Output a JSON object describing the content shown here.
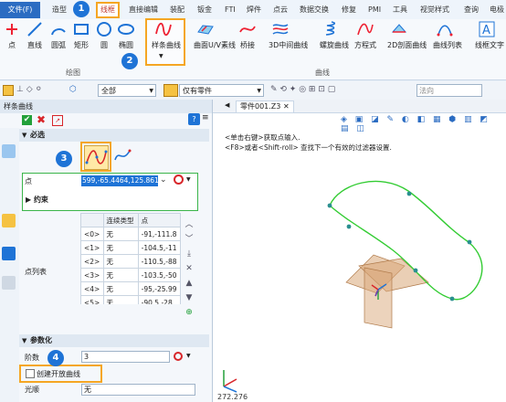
{
  "menu": {
    "file": "文件(F)",
    "tabs": [
      "造型",
      "线框",
      "直接编辑",
      "装配",
      "钣金",
      "FTI",
      "焊件",
      "点云",
      "数据交换",
      "修复",
      "PMI",
      "工具",
      "视觉样式",
      "查询",
      "电极"
    ]
  },
  "ribbon": {
    "buttons": [
      "点",
      "直线",
      "圆弧",
      "矩形",
      "圆",
      "椭圆",
      "样条曲线",
      "曲面U/V素线",
      "桥接",
      "3D中间曲线",
      "螺旋曲线",
      "方程式",
      "2D剖面曲线",
      "曲线列表",
      "线框文字"
    ],
    "groups": [
      "绘图",
      "曲线"
    ]
  },
  "toolbar": {
    "filter_value": "全部",
    "part_value": "仅有零件",
    "normal_label": "法向"
  },
  "panel": {
    "title": "样条曲线",
    "help": "?",
    "required_section": "必选",
    "point_label": "点",
    "point_value": "599,-65.4464,125.861",
    "constraint_label": "约束",
    "list_label": "点列表",
    "table_headers": [
      "",
      "连续类型",
      "点"
    ],
    "rows": [
      {
        "id": "<0>",
        "type": "无",
        "point": "-91,-111.8"
      },
      {
        "id": "<1>",
        "type": "无",
        "point": "-104.5,-11"
      },
      {
        "id": "<2>",
        "type": "无",
        "point": "-110.5,-88"
      },
      {
        "id": "<3>",
        "type": "无",
        "point": "-103.5,-50"
      },
      {
        "id": "<4>",
        "type": "无",
        "point": "-95,-25.99"
      },
      {
        "id": "<5>",
        "type": "无",
        "point": "-90.5,-28."
      }
    ],
    "param_section": "参数化",
    "order_label": "阶数",
    "order_value": "3",
    "open_curve_label": "创建开放曲线",
    "smooth_label": "光顺",
    "smooth_value": "无"
  },
  "viewport": {
    "tab_title": "零件001.Z3",
    "hint1": "<单击右键>获取点输入.",
    "hint2": "<F8>或者<Shift-roll> 查找下一个有效的过滤器设置.",
    "coord_text": "272.276"
  },
  "callouts": [
    "1",
    "2",
    "3",
    "4"
  ],
  "colors": {
    "accent": "#f5a623",
    "badge": "#1e73d6",
    "curve": "#33cc33"
  }
}
